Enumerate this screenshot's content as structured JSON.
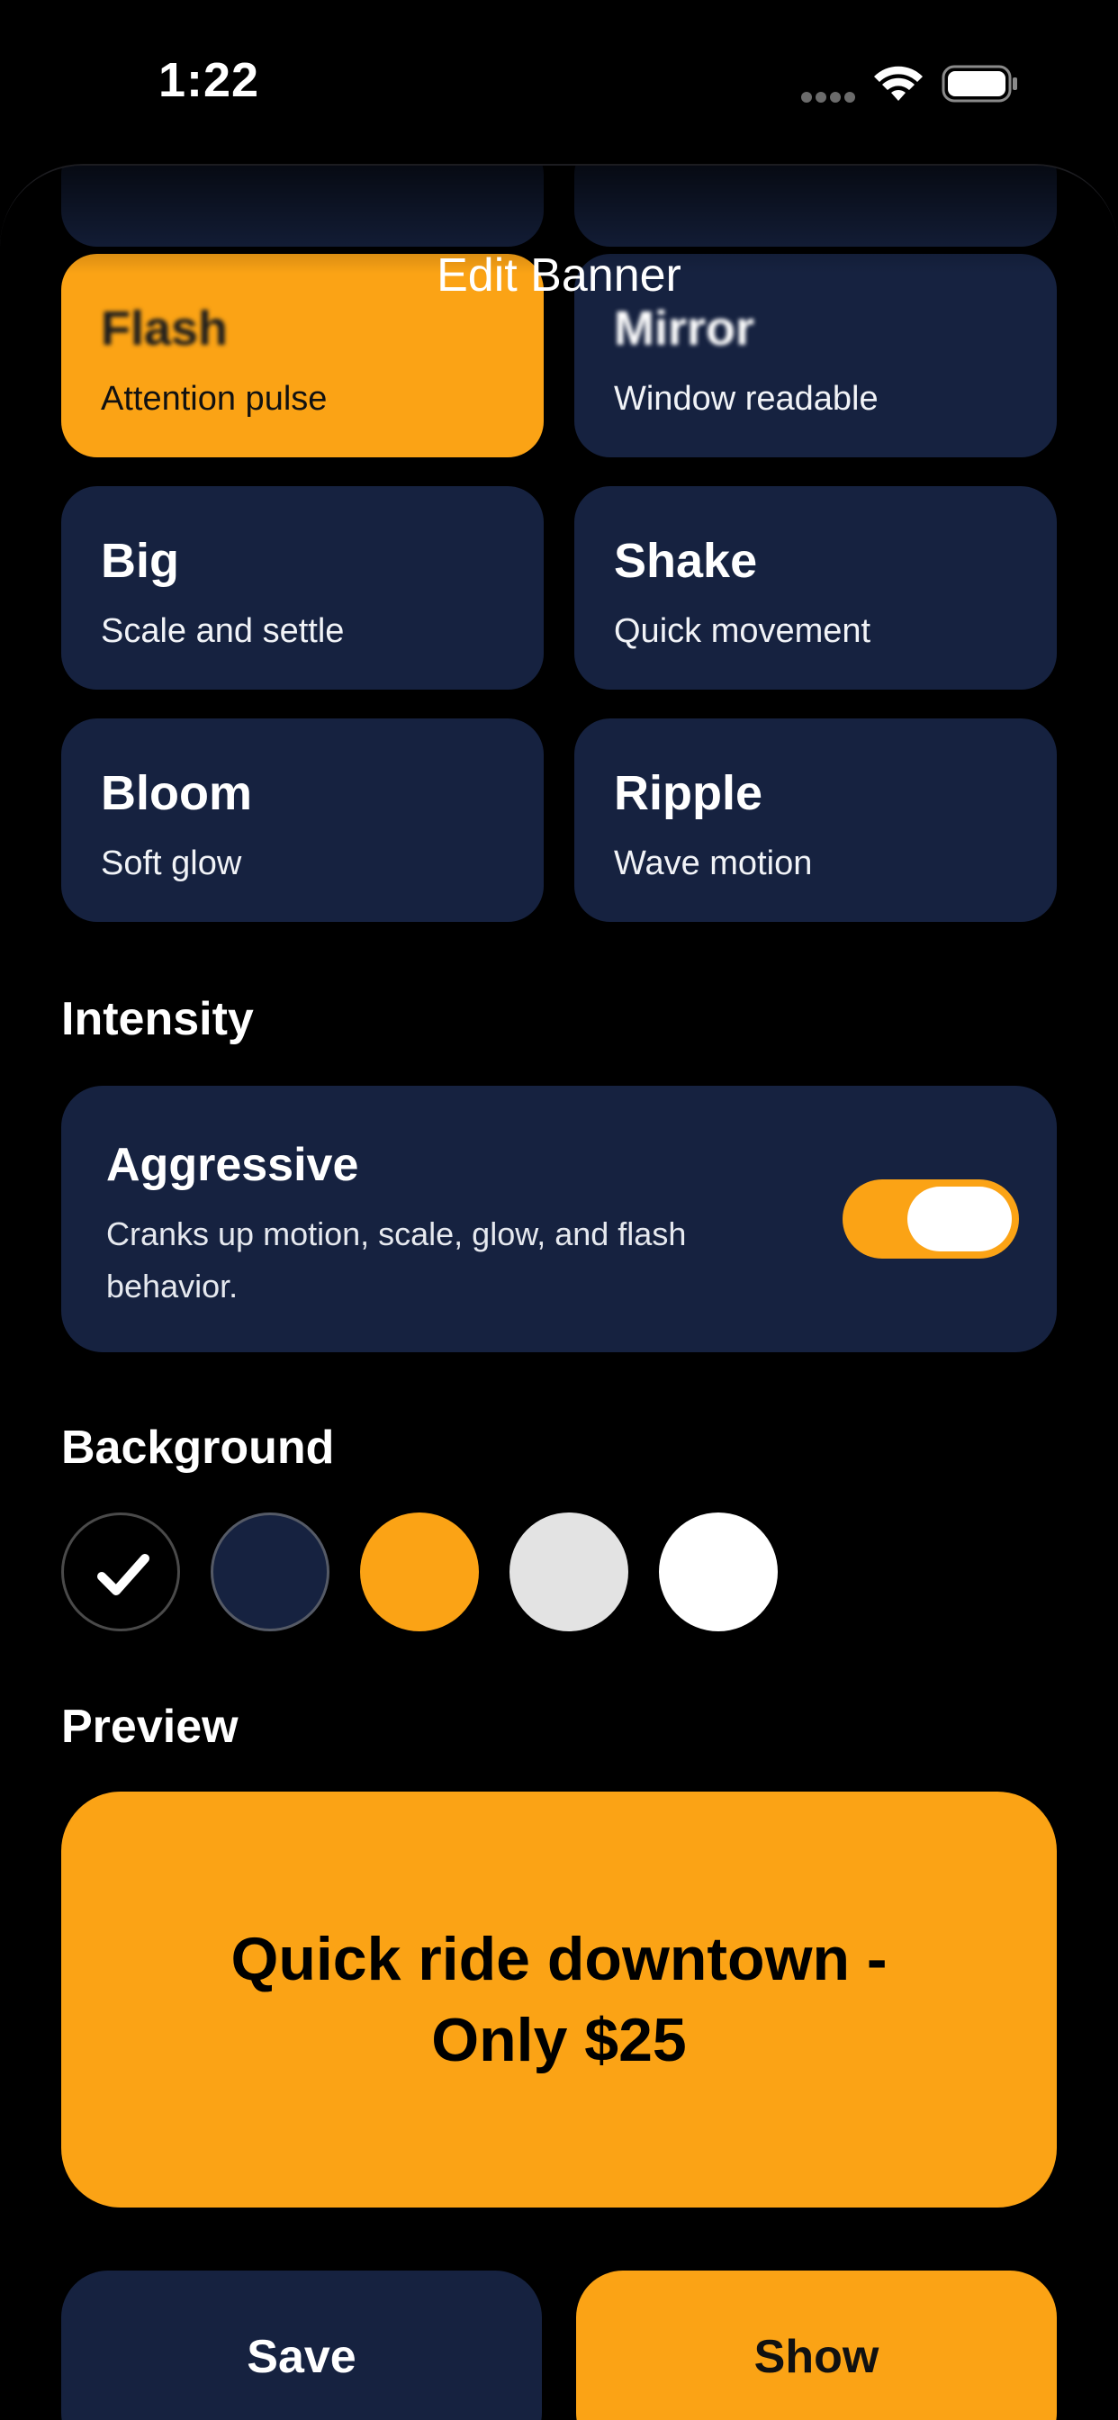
{
  "status_bar": {
    "time": "1:22"
  },
  "sheet": {
    "title": "Edit Banner"
  },
  "styles": {
    "partial": [
      "",
      ""
    ],
    "items": [
      {
        "title": "Flash",
        "subtitle": "Attention pulse",
        "selected": true
      },
      {
        "title": "Mirror",
        "subtitle": "Window readable",
        "selected": false
      },
      {
        "title": "Big",
        "subtitle": "Scale and settle",
        "selected": false
      },
      {
        "title": "Shake",
        "subtitle": "Quick movement",
        "selected": false
      },
      {
        "title": "Bloom",
        "subtitle": "Soft glow",
        "selected": false
      },
      {
        "title": "Ripple",
        "subtitle": "Wave motion",
        "selected": false
      }
    ]
  },
  "intensity": {
    "label": "Intensity",
    "title": "Aggressive",
    "description": "Cranks up motion, scale, glow, and flash behavior.",
    "enabled": true
  },
  "background": {
    "label": "Background",
    "swatches": [
      {
        "name": "black",
        "color": "#000000",
        "selected": true
      },
      {
        "name": "navy",
        "color": "#162240",
        "selected": false
      },
      {
        "name": "orange",
        "color": "#fba315",
        "selected": false
      },
      {
        "name": "light-gray",
        "color": "#e3e3e3",
        "selected": false
      },
      {
        "name": "white",
        "color": "#ffffff",
        "selected": false
      }
    ]
  },
  "preview": {
    "label": "Preview",
    "text": "Quick ride downtown - Only $25"
  },
  "actions": {
    "save": "Save",
    "show": "Show"
  },
  "colors": {
    "accent": "#fba315",
    "card": "#162240",
    "background": "#000000"
  }
}
